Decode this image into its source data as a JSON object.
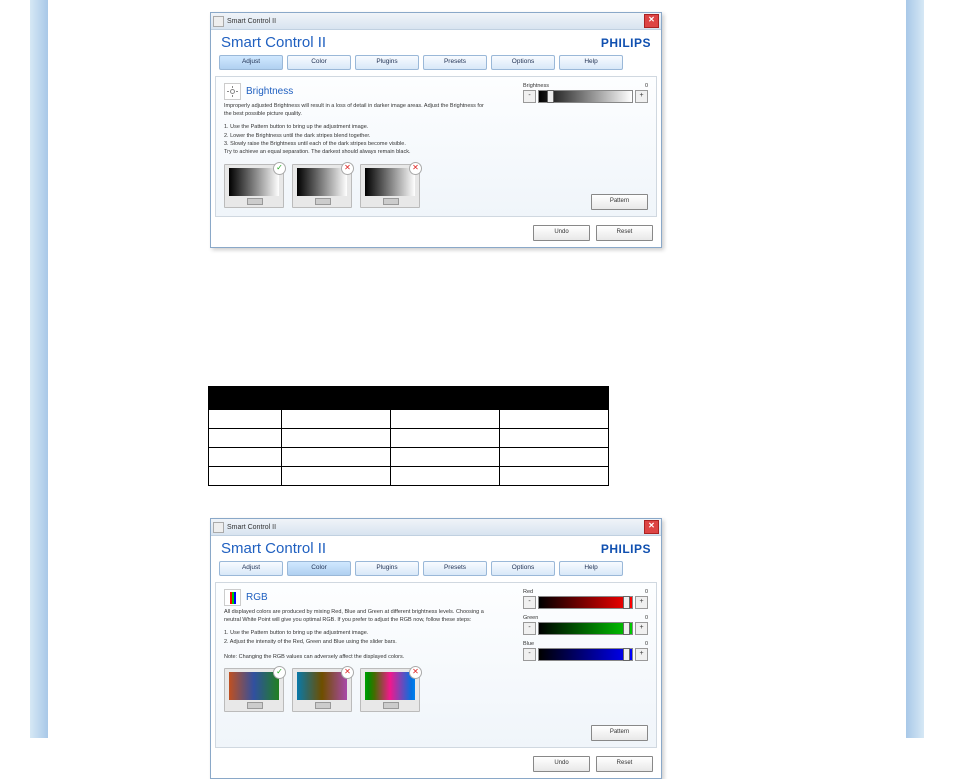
{
  "titlebar": "Smart Control II",
  "app_title": "Smart Control II",
  "brand": "PHILIPS",
  "close_glyph": "✕",
  "menu": {
    "adjust": "Adjust",
    "color": "Color",
    "plugins": "Plugins",
    "presets": "Presets",
    "options": "Options",
    "help": "Help"
  },
  "brightness": {
    "title": "Brightness",
    "desc": "Improperly adjusted Brightness will result in a loss of detail in darker image areas. Adjust the Brightness for the best possible picture quality.",
    "step1": "1. Use the Pattern button to bring up the adjustment image.",
    "step2": "2. Lower the Brightness until the dark stripes blend together.",
    "step3": "3. Slowly raise the Brightness until each of the dark stripes become visible.",
    "step3b": "   Try to achieve an equal separation. The darkest should always remain black.",
    "slider_label": "Brightness",
    "slider_value": "0",
    "minus": "-",
    "plus": "+",
    "pattern": "Pattern",
    "undo": "Undo",
    "reset": "Reset",
    "ok": "✓",
    "no": "✕"
  },
  "rgb": {
    "title": "RGB",
    "desc": "All displayed colors are produced by mixing Red, Blue and Green at different brightness levels. Choosing a neutral White Point will give you optimal RGB. If you prefer to adjust the RGB now, follow these steps:",
    "step1": "1. Use the Pattern button to bring up the adjustment image.",
    "step2": "2. Adjust the intensity of the Red, Green and Blue using the slider bars.",
    "note": "Note: Changing the RGB values can adversely affect the displayed colors.",
    "red_label": "Red",
    "red_value": "0",
    "green_label": "Green",
    "green_value": "0",
    "blue_label": "Blue",
    "blue_value": "0",
    "minus": "-",
    "plus": "+",
    "pattern": "Pattern",
    "undo": "Undo",
    "reset": "Reset",
    "ok": "✓",
    "no": "✕"
  },
  "table": {
    "h1": "",
    "h2": "",
    "h3": "",
    "h4": "",
    "rows": 4
  }
}
